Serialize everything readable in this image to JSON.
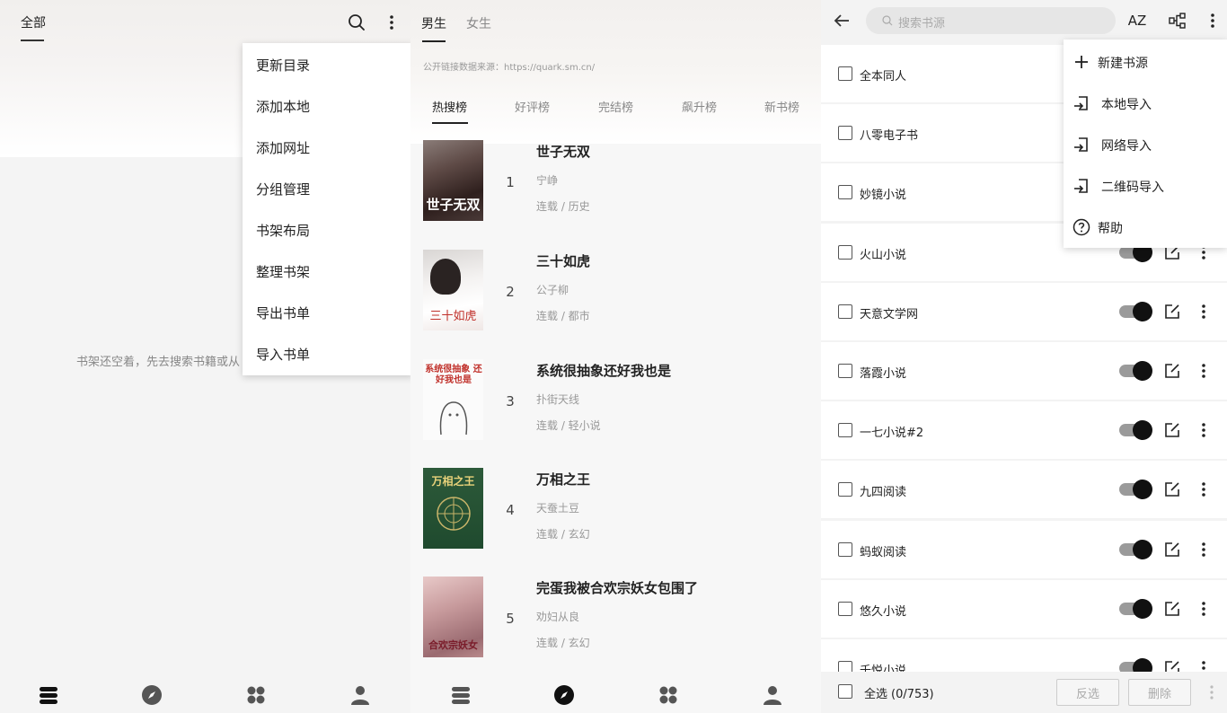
{
  "bookshelf": {
    "tab_all": "全部",
    "empty_text": "书架还空着，先去搜索书籍或从",
    "menu": [
      "更新目录",
      "添加本地",
      "添加网址",
      "分组管理",
      "书架布局",
      "整理书架",
      "导出书单",
      "导入书单"
    ]
  },
  "discover": {
    "gender_tabs": [
      "男生",
      "女生"
    ],
    "source_note": "公开链接数据来源：https://quark.sm.cn/",
    "rank_tabs": [
      "热搜榜",
      "好评榜",
      "完结榜",
      "飙升榜",
      "新书榜"
    ],
    "books": [
      {
        "rank": "1",
        "title": "世子无双",
        "author": "宁峥",
        "tags": "连载 / 历史",
        "cover_text": "世子无双"
      },
      {
        "rank": "2",
        "title": "三十如虎",
        "author": "公子柳",
        "tags": "连载 / 都市",
        "cover_text": "三十如虎"
      },
      {
        "rank": "3",
        "title": "系统很抽象还好我也是",
        "author": "扑街天线",
        "tags": "连载 / 轻小说",
        "cover_text": "系统很抽象 还好我也是"
      },
      {
        "rank": "4",
        "title": "万相之王",
        "author": "天蚕土豆",
        "tags": "连载 / 玄幻",
        "cover_text": "万相之王"
      },
      {
        "rank": "5",
        "title": "完蛋我被合欢宗妖女包围了",
        "author": "劝妇从良",
        "tags": "连载 / 玄幻",
        "cover_text": "合欢宗妖女"
      }
    ]
  },
  "sources": {
    "search_placeholder": "搜索书源",
    "sort_label": "AZ",
    "rows": [
      "全本同人",
      "八零电子书",
      "妙镜小说",
      "火山小说",
      "天意文学网",
      "落霞小说",
      "一七小说#2",
      "九四阅读",
      "蚂蚁阅读",
      "悠久小说",
      "千悦小说"
    ],
    "menu": [
      "新建书源",
      "本地导入",
      "网络导入",
      "二维码导入",
      "帮助"
    ],
    "select_all": "全选",
    "count": "(0/753)",
    "invert_label": "反选",
    "delete_label": "删除"
  },
  "colors": {
    "accent": "#111111",
    "toggle_track": "#9a9a9a",
    "muted_text": "#999999"
  },
  "icons": [
    "search-icon",
    "more-vert-icon",
    "bookshelf-icon",
    "compass-icon",
    "apps-icon",
    "person-icon",
    "back-arrow-icon",
    "sort-az-icon",
    "group-icon",
    "edit-icon",
    "plus-icon",
    "import-icon",
    "help-icon"
  ]
}
